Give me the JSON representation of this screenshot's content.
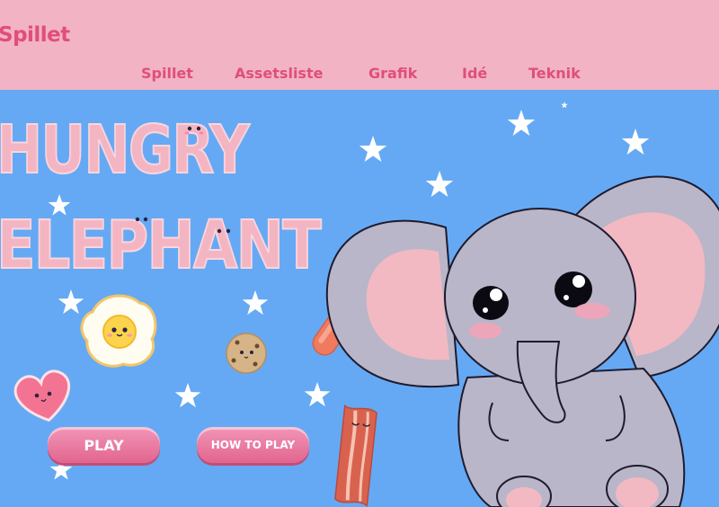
{
  "site": {
    "brand": "Spillet"
  },
  "nav": {
    "items": [
      {
        "label": "Spillet"
      },
      {
        "label": "Assetsliste"
      },
      {
        "label": "Grafik"
      },
      {
        "label": "Idé"
      },
      {
        "label": "Teknik"
      }
    ]
  },
  "game": {
    "title_line1": "HUNGRY",
    "title_line2": "ELEPHANT",
    "play_label": "PLAY",
    "how_to_play_label": "HOW TO PLAY"
  },
  "colors": {
    "header_bg": "#f2b3c5",
    "accent": "#e04e7c",
    "sky": "#65a9f4",
    "button": "#e8769c",
    "elephant": "#b8b6c8",
    "title_letters": "#f4b5c3"
  },
  "icons": [
    "star-icon",
    "fried-egg-icon",
    "heart-icon",
    "cookie-icon",
    "sausage-icon",
    "bacon-icon",
    "elephant-character"
  ]
}
